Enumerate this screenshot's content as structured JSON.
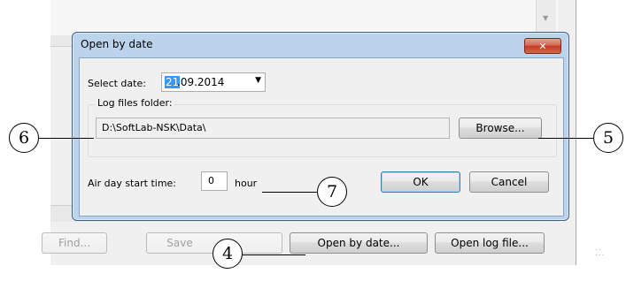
{
  "dialog": {
    "title": "Open by date",
    "close_icon": "close-icon",
    "select_date_label": "Select date:",
    "date_value_selected": "21",
    "date_value_rest": ".09.2014",
    "log_folder_label": "Log files folder:",
    "log_folder_path": "D:\\SoftLab-NSK\\Data\\",
    "browse_label": "Browse...",
    "air_day_label": "Air day start time:",
    "air_day_value": "0",
    "hour_label": "hour",
    "ok_label": "OK",
    "cancel_label": "Cancel"
  },
  "toolbar": {
    "find_label": "Find...",
    "save_label": "Save",
    "open_by_date_label": "Open by date...",
    "open_log_file_label": "Open log file..."
  },
  "callouts": {
    "c4": "4",
    "c5": "5",
    "c6": "6",
    "c7": "7"
  },
  "colors": {
    "dialog_frame": "#bcd3ec",
    "close_button": "#c23b22",
    "selection": "#3399ff"
  }
}
